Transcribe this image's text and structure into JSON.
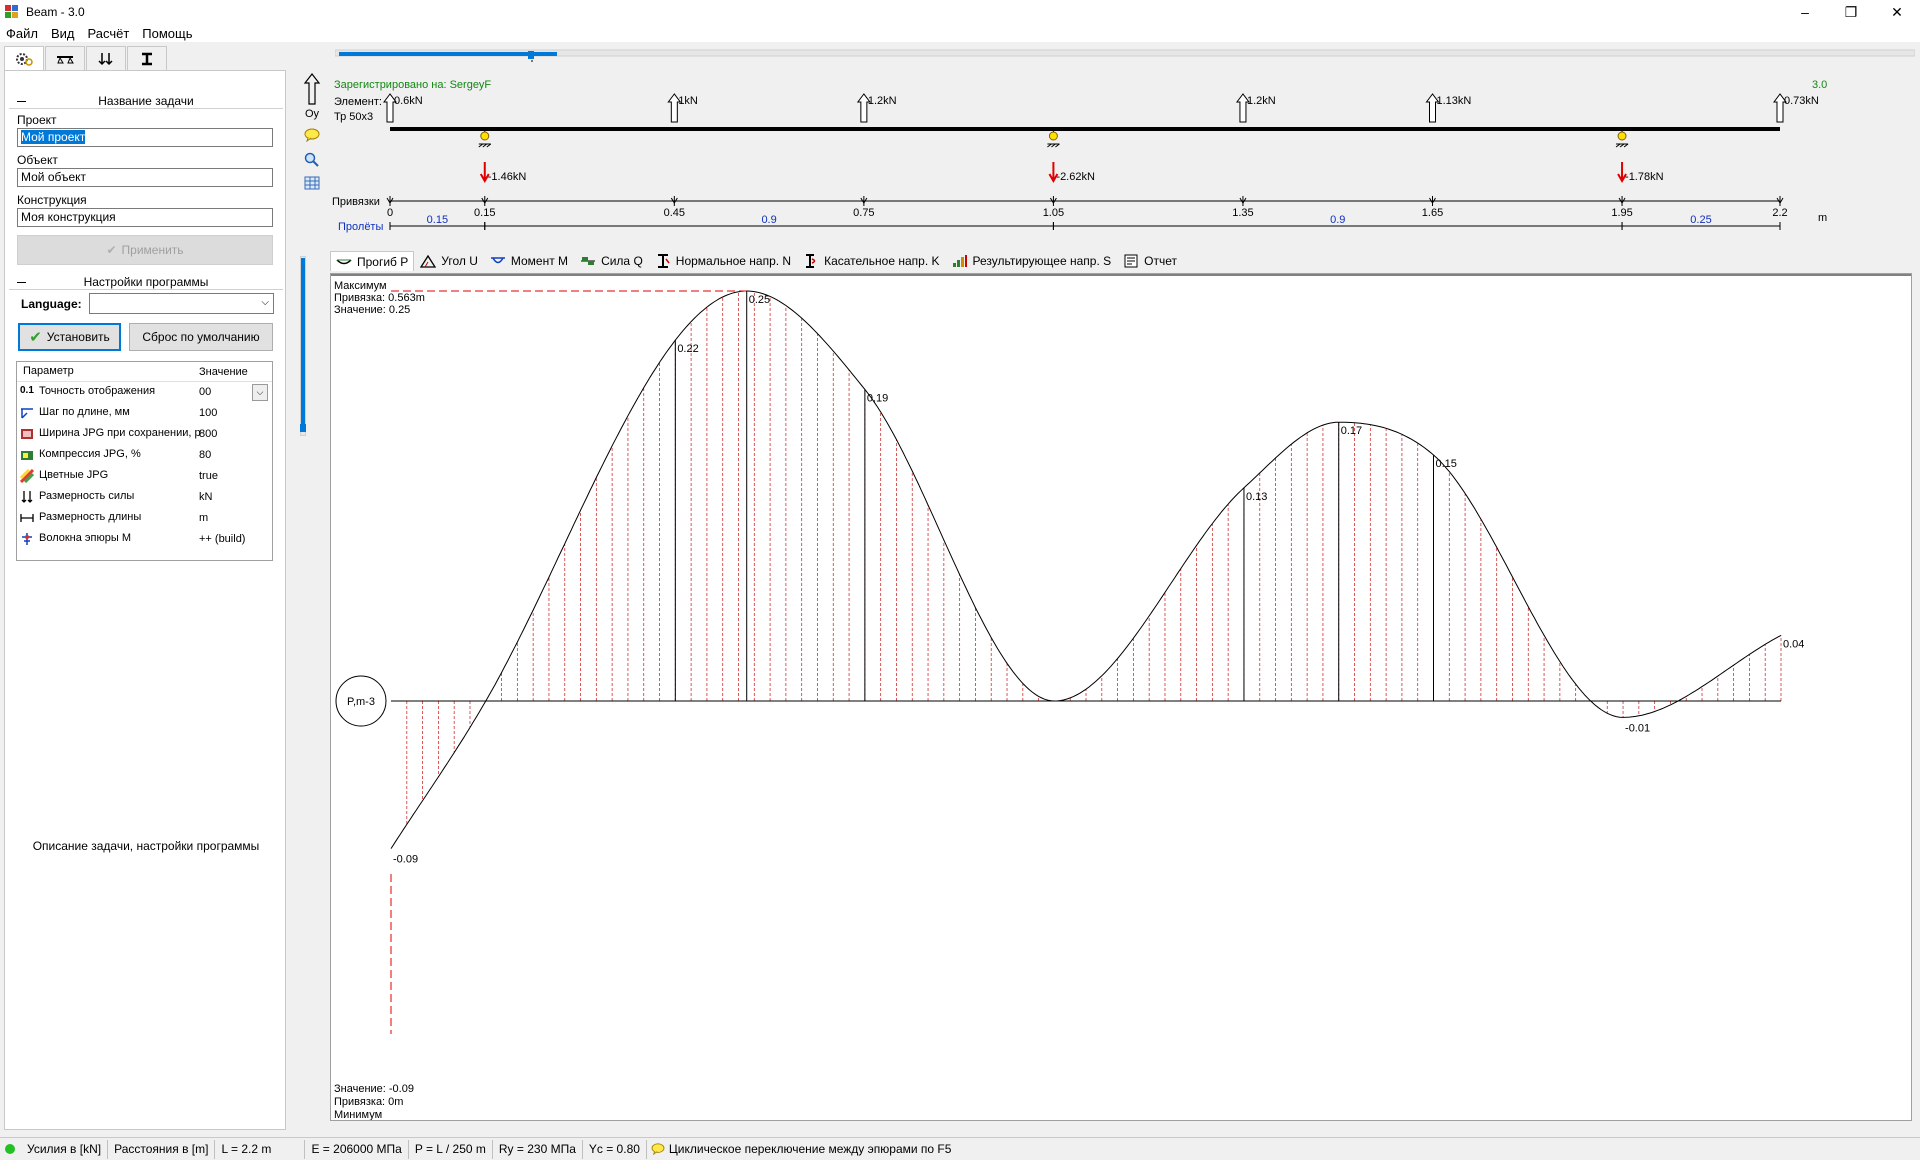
{
  "window": {
    "title": "Beam - 3.0"
  },
  "menu": [
    "Файл",
    "Вид",
    "Расчёт",
    "Помощь"
  ],
  "left": {
    "task_header": "Название задачи",
    "project_label": "Проект",
    "project_value": "Мой проект",
    "object_label": "Объект",
    "object_value": "Мой объект",
    "construction_label": "Конструкция",
    "construction_value": "Моя конструкция",
    "apply_button": "Применить",
    "settings_header": "Настройки программы",
    "language_label": "Language:",
    "language_value": "",
    "install_button": "Установить",
    "reset_button": "Сброс по умолчанию",
    "param_col": "Параметр",
    "value_col": "Значение",
    "params": [
      {
        "name": "Точность отображения",
        "value": "00",
        "icon": "precision-icon"
      },
      {
        "name": "Шаг по длине, мм",
        "value": "100",
        "icon": "step-icon"
      },
      {
        "name": "Ширина JPG при сохранении, р",
        "value": "800",
        "icon": "jpg-width-icon"
      },
      {
        "name": "Компрессия JPG, %",
        "value": "80",
        "icon": "compression-icon"
      },
      {
        "name": "Цветные JPG",
        "value": "true",
        "icon": "color-icon"
      },
      {
        "name": "Размерность силы",
        "value": "kN",
        "icon": "force-unit-icon"
      },
      {
        "name": "Размерность длины",
        "value": "m",
        "icon": "length-unit-icon"
      },
      {
        "name": "Волокна эпюры М",
        "value": "++ (build)",
        "icon": "fibers-icon"
      }
    ],
    "description": "Описание задачи, настройки программы"
  },
  "beam": {
    "registered": "Зарегистрировано на: SergeyF",
    "version": "3.0",
    "element_label": "Элемент:",
    "element_value": "Тр 50x3",
    "oy_label": "Oy",
    "bindings_label": "Привязки",
    "spans_label": "Пролёты",
    "unit_m": "m",
    "loads": [
      {
        "x": 0,
        "label": "0.6kN"
      },
      {
        "x": 0.45,
        "label": "1kN"
      },
      {
        "x": 0.75,
        "label": "1.2kN"
      },
      {
        "x": 1.35,
        "label": "1.2kN"
      },
      {
        "x": 1.65,
        "label": "1.13kN"
      },
      {
        "x": 2.2,
        "label": "0.73kN"
      }
    ],
    "reactions": [
      {
        "x": 0.15,
        "label": "-1.46kN"
      },
      {
        "x": 1.05,
        "label": "-2.62kN"
      },
      {
        "x": 1.95,
        "label": "-1.78kN"
      }
    ],
    "ticks": [
      "0",
      "0.15",
      "0.45",
      "0.75",
      "1.05",
      "1.35",
      "1.65",
      "1.95",
      "2.2"
    ],
    "tick_values": [
      0,
      0.15,
      0.45,
      0.75,
      1.05,
      1.35,
      1.65,
      1.95,
      2.2
    ],
    "spans": [
      {
        "from": 0,
        "to": 0.15,
        "label": "0.15"
      },
      {
        "from": 0.15,
        "to": 1.05,
        "label": "0.9"
      },
      {
        "from": 1.05,
        "to": 1.95,
        "label": "0.9"
      },
      {
        "from": 1.95,
        "to": 2.2,
        "label": "0.25"
      }
    ]
  },
  "tabs": [
    "Прогиб P",
    "Угол U",
    "Момент M",
    "Сила Q",
    "Нормальное напр. N",
    "Касательное напр. K",
    "Результирующее напр. S",
    "Отчет"
  ],
  "plot": {
    "max_title": "Максимум",
    "max_binding": "Привязка: 0.563m",
    "max_value": "Значение: 0.25",
    "min_value": "Значение: -0.09",
    "min_binding": "Привязка: 0m",
    "min_title": "Минимум",
    "circle_label": "P,m-3"
  },
  "chart_data": {
    "type": "line",
    "title": "Прогиб P",
    "ylabel": "P,m-3",
    "x": [
      0,
      0.15,
      0.45,
      0.563,
      0.75,
      1.05,
      1.35,
      1.5,
      1.65,
      1.95,
      2.2
    ],
    "values": [
      -0.09,
      0.0,
      0.22,
      0.25,
      0.19,
      0.0,
      0.13,
      0.17,
      0.15,
      -0.01,
      0.04
    ],
    "point_labels": [
      {
        "x": 0,
        "label": "-0.09"
      },
      {
        "x": 0.45,
        "label": "0.22"
      },
      {
        "x": 0.563,
        "label": "0.25"
      },
      {
        "x": 0.75,
        "label": "0.19"
      },
      {
        "x": 1.35,
        "label": "0.13"
      },
      {
        "x": 1.5,
        "label": "0.17"
      },
      {
        "x": 1.65,
        "label": "0.15"
      },
      {
        "x": 1.95,
        "label": "-0.01"
      },
      {
        "x": 2.2,
        "label": "0.04"
      }
    ],
    "xlim": [
      0,
      2.2
    ]
  },
  "status": [
    "Усилия в [kN]",
    "Расстояния в [m]",
    "L = 2.2 m",
    "E = 206000 МПа",
    "P = L / 250 m",
    "Ry = 230 МПа",
    "Yc = 0.80",
    "Циклическое переключение между эпюрами по F5"
  ]
}
